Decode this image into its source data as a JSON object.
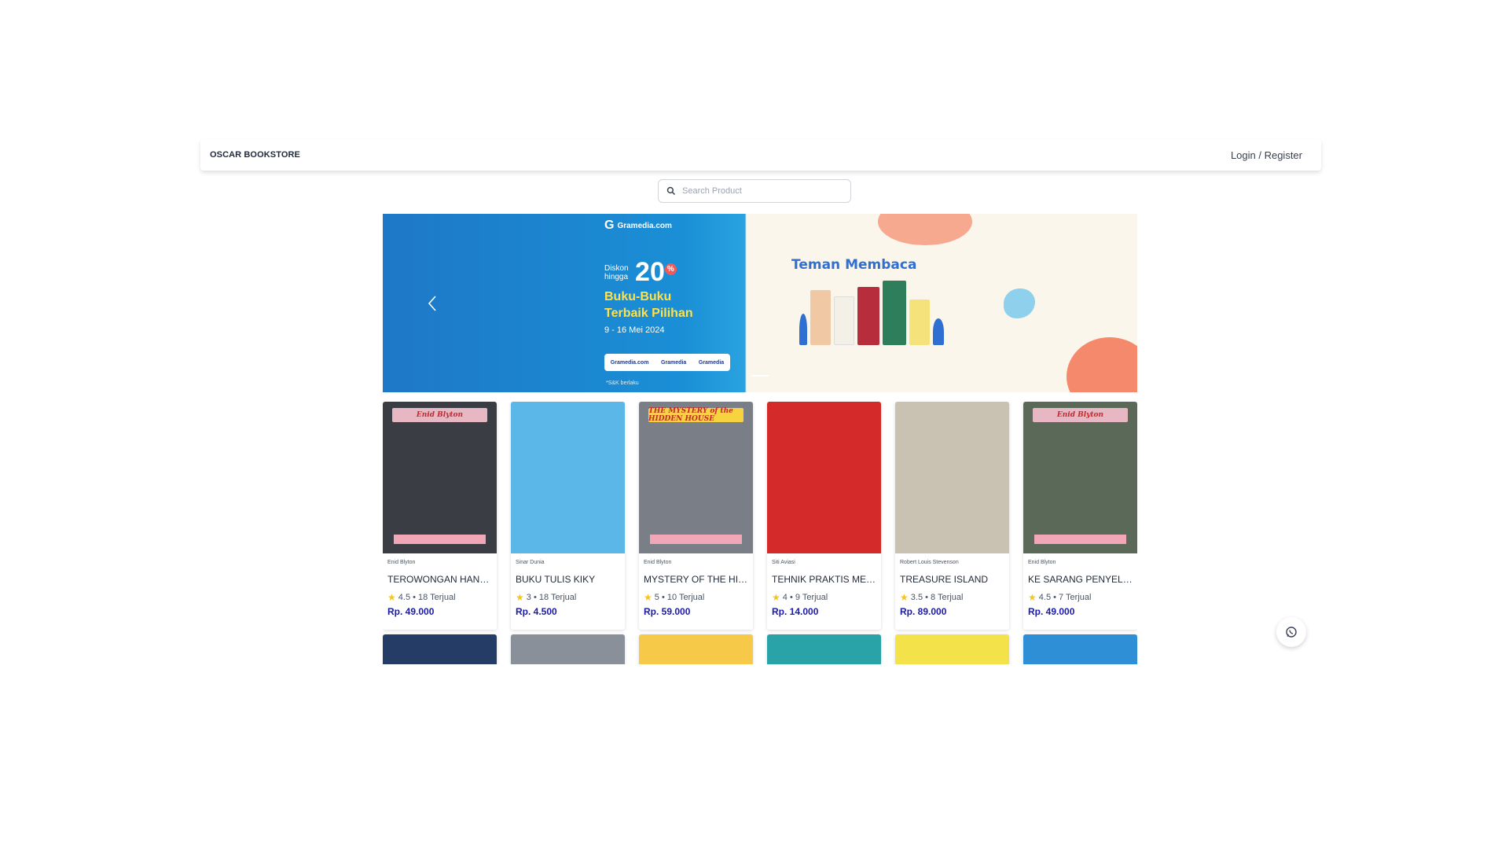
{
  "nav": {
    "brand": "OSCAR BOOKSTORE",
    "login": "Login / Register"
  },
  "search": {
    "placeholder": "Search Product"
  },
  "banner": {
    "logo": "Gramedia.com",
    "diskon_line1": "Diskon",
    "diskon_line2": "hingga",
    "percent": "20",
    "percent_sign": "%",
    "headline1": "Buku-Buku",
    "headline2": "Terbaik Pilihan",
    "date": "9 - 16 Mei 2024",
    "partner1": "Gramedia.com",
    "partner2": "Gramedia",
    "partner3": "Gramedia",
    "terms": "*S&K berlaku",
    "campaign": "Teman Membaca"
  },
  "products": [
    {
      "author": "Enid Blyton",
      "title": "TEROWONGAN HANTU",
      "rating": "4.5 • 18 Terjual",
      "price": "Rp. 49.000",
      "cover_color": "#3a3d44",
      "tag": "Enid Blyton",
      "tag_bg": "#e8b7c4"
    },
    {
      "author": "Sinar Dunia",
      "title": "BUKU TULIS KIKY",
      "rating": "3 • 18 Terjual",
      "price": "Rp. 4.500",
      "cover_color": "#5ab7e8",
      "tag": "",
      "tag_bg": "transparent"
    },
    {
      "author": "Enid Blyton",
      "title": "MYSTERY OF THE HIDDEN HOUSE",
      "rating": "5 • 10 Terjual",
      "price": "Rp. 59.000",
      "cover_color": "#7a7f87",
      "tag": "THE MYSTERY of the HIDDEN HOUSE",
      "tag_bg": "#f6d33f"
    },
    {
      "author": "Siti Aviasi",
      "title": "TEHNIK PRAKTIS MENGIRINGI LAGU & MELODI",
      "rating": "4 • 9 Terjual",
      "price": "Rp. 14.000",
      "cover_color": "#d42a2a",
      "tag": "",
      "tag_bg": "transparent"
    },
    {
      "author": "Robert Louis Stevenson",
      "title": "TREASURE ISLAND",
      "rating": "3.5 • 8 Terjual",
      "price": "Rp. 89.000",
      "cover_color": "#c9c1b2",
      "tag": "",
      "tag_bg": "transparent"
    },
    {
      "author": "Enid Blyton",
      "title": "KE SARANG PENYELUNDUP",
      "rating": "4.5 • 7 Terjual",
      "price": "Rp. 49.000",
      "cover_color": "#5b6a58",
      "tag": "Enid Blyton",
      "tag_bg": "#e8b7c4"
    }
  ],
  "next_row_colors": [
    "#243c66",
    "#8a9099",
    "#f7c948",
    "#2aa3a8",
    "#f3e24a",
    "#2f8fd6"
  ],
  "whatsapp": {
    "icon": "whatsapp-icon"
  }
}
